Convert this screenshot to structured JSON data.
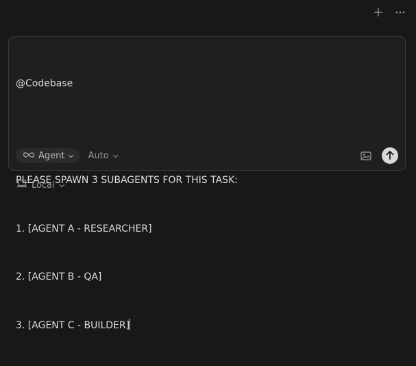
{
  "toolbar": {
    "new_icon": "plus-icon",
    "more_icon": "ellipsis-icon"
  },
  "composer": {
    "lines": [
      "@Codebase",
      "",
      "PLEASE SPAWN 3 SUBAGENTS FOR THIS TASK:",
      "1. [AGENT A - RESEARCHER]",
      "2. [AGENT B - QA]",
      "3. [AGENT C - BUILDER]"
    ],
    "mode_label": "Agent",
    "mode_icon": "infinity-icon",
    "model_label": "Auto",
    "image_icon": "image-icon",
    "send_icon": "arrow-up-icon"
  },
  "environment": {
    "label": "Local",
    "icon": "laptop-icon"
  },
  "colors": {
    "background": "#181818",
    "composer_bg": "#1f1f1f",
    "composer_border": "#3a3a3a",
    "send_button": "#d9d9d9"
  }
}
